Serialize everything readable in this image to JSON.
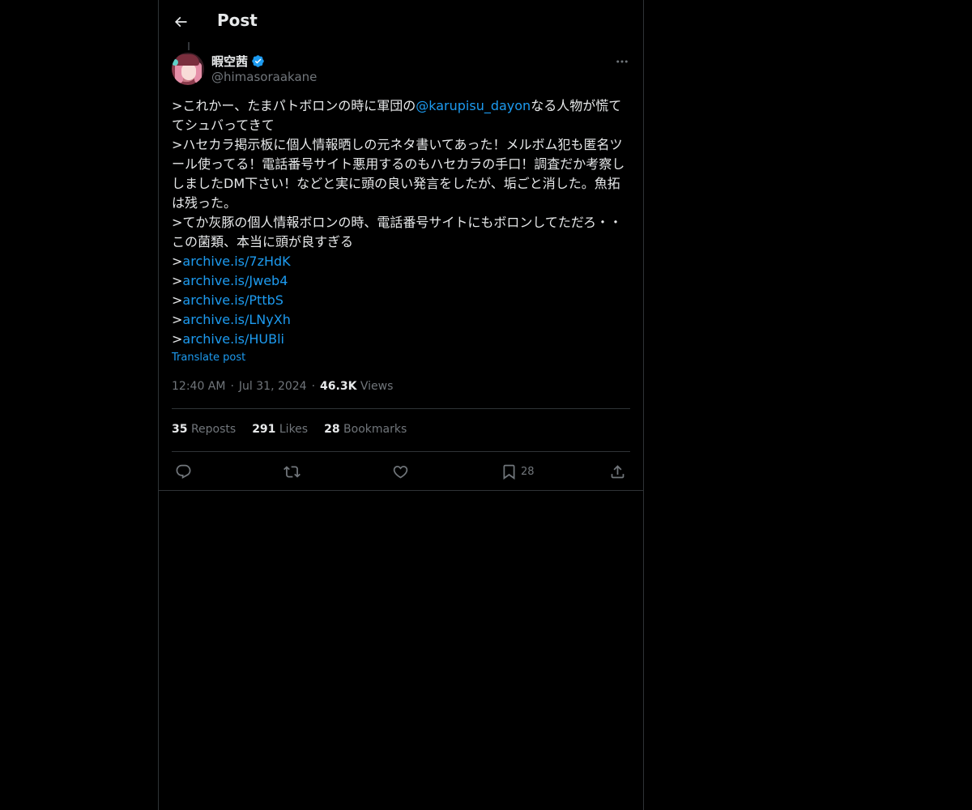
{
  "header": {
    "title": "Post"
  },
  "author": {
    "name": "暇空茜",
    "handle": "@himasoraakane"
  },
  "tweet": {
    "line1_pre": ">これかー、たまパトボロンの時に軍団の",
    "mention": "@karupisu_dayon",
    "line1_post": "なる人物が慌ててシュバってきて",
    "line2": ">ハセカラ掲示板に個人情報晒しの元ネタ書いてあった！メルボム犯も匿名ツール使ってる！電話番号サイト悪用するのもハセカラの手口！調査だか考察ししましたDM下さい！などと実に頭の良い発言をしたが、垢ごと消した。魚拓は残った。",
    "line3": ">てか灰豚の個人情報ボロンの時、電話番号サイトにもボロンしてただろ・・この菌類、本当に頭が良すぎる",
    "prefix": ">",
    "links": [
      "archive.is/7zHdK",
      "archive.is/Jweb4",
      "archive.is/PttbS",
      "archive.is/LNyXh",
      "archive.is/HUBli"
    ],
    "translate": "Translate post"
  },
  "meta": {
    "time": "12:40 AM",
    "sep": "·",
    "date": "Jul 31, 2024",
    "views_count": "46.3K",
    "views_label": "Views"
  },
  "stats": {
    "reposts_count": "35",
    "reposts_label": "Reposts",
    "likes_count": "291",
    "likes_label": "Likes",
    "bookmarks_count": "28",
    "bookmarks_label": "Bookmarks"
  },
  "actions": {
    "bookmark_count": "28"
  },
  "colors": {
    "accent": "#1d9bf0",
    "background": "#000000",
    "text": "#e7e9ea",
    "muted": "#71767b",
    "border": "#2f3336"
  },
  "icons": [
    "back-arrow-icon",
    "verified-badge-icon",
    "more-icon",
    "reply-icon",
    "repost-icon",
    "like-icon",
    "bookmark-icon",
    "share-icon"
  ]
}
